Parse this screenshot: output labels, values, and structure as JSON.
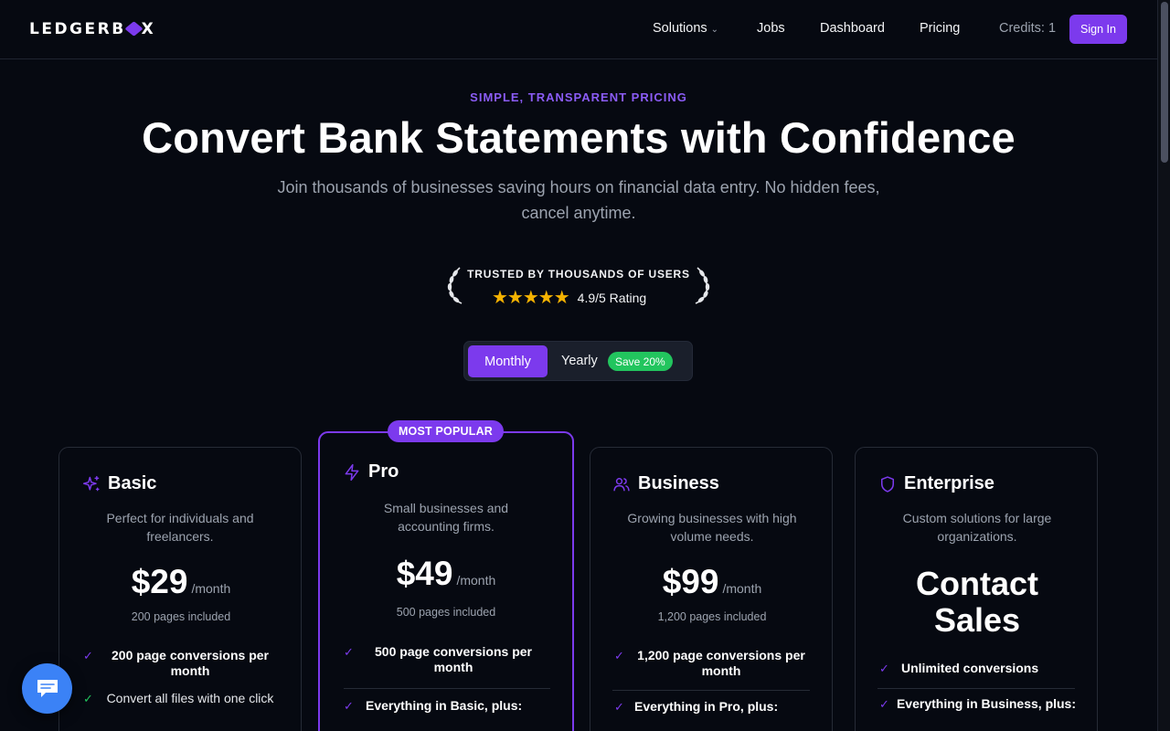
{
  "nav": {
    "logo_pre": "LEDGERB",
    "logo_post": "X",
    "items": [
      {
        "label": "Solutions"
      },
      {
        "label": "Jobs"
      },
      {
        "label": "Dashboard"
      },
      {
        "label": "Pricing"
      }
    ],
    "credits": "Credits: 1",
    "signin": "Sign In"
  },
  "hero": {
    "eyebrow": "SIMPLE, TRANSPARENT PRICING",
    "headline": "Convert Bank Statements with Confidence",
    "subhead": "Join thousands of businesses saving hours on financial data entry. No hidden fees, cancel anytime."
  },
  "trust": {
    "title": "TRUSTED BY THOUSANDS OF USERS",
    "stars": "★★★★★",
    "rating": "4.9/5 Rating"
  },
  "billing_toggle": {
    "monthly": "Monthly",
    "yearly": "Yearly",
    "save_badge": "Save 20%"
  },
  "plans": [
    {
      "name": "Basic",
      "icon": "sparkles-icon",
      "description": "Perfect for individuals and freelancers.",
      "price": "$29",
      "per": "/month",
      "included": "200 pages included",
      "features": [
        "200 page conversions per month",
        "Convert all files with one click"
      ]
    },
    {
      "name": "Pro",
      "icon": "lightning-icon",
      "badge": "MOST POPULAR",
      "description": "Small businesses and accounting firms.",
      "price": "$49",
      "per": "/month",
      "included": "500 pages included",
      "features": [
        "500 page conversions per month",
        "Everything in Basic, plus:"
      ]
    },
    {
      "name": "Business",
      "icon": "users-icon",
      "description": "Growing businesses with high volume needs.",
      "price": "$99",
      "per": "/month",
      "included": "1,200 pages included",
      "features": [
        "1,200 page conversions per month",
        "Everything in Pro, plus:"
      ]
    },
    {
      "name": "Enterprise",
      "icon": "shield-icon",
      "description": "Custom solutions for large organizations.",
      "price_text": "Contact Sales",
      "features": [
        "Unlimited conversions",
        "Everything in Business, plus:"
      ]
    }
  ],
  "colors": {
    "accent": "#7c3aed",
    "background": "#060911",
    "success": "#22c55e",
    "star": "#f5b301",
    "chat": "#3b82f6"
  },
  "chat": {
    "icon": "chat-bubble-icon"
  }
}
